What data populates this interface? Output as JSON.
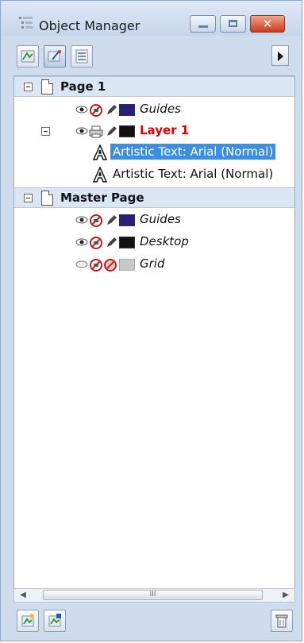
{
  "window": {
    "title": "Object Manager",
    "controls": {
      "minimize": "minimize",
      "maximize": "maximize",
      "close": "✕"
    }
  },
  "toolbar": {
    "buttons": [
      "show-object-properties-icon",
      "edit-across-layers-icon",
      "layer-manager-view-icon"
    ],
    "flyout_arrow": "flyout-menu-arrow-icon"
  },
  "tree": {
    "page1": {
      "label": "Page 1",
      "layers": [
        {
          "label": "Guides",
          "color": "#2a1f7a",
          "style": "italic"
        },
        {
          "label": "Layer 1",
          "color": "#111111",
          "style": "active-red",
          "objects": [
            {
              "label": "Artistic Text: Arial (Normal)",
              "selected": true
            },
            {
              "label": "Artistic Text: Arial (Normal)",
              "selected": false
            }
          ]
        }
      ]
    },
    "master": {
      "label": "Master Page",
      "layers": [
        {
          "label": "Guides",
          "color": "#2a1f7a"
        },
        {
          "label": "Desktop",
          "color": "#111111"
        },
        {
          "label": "Grid",
          "color": "#c8c8c8"
        }
      ]
    }
  },
  "scrollbar": {
    "thumb_grip": "III"
  },
  "bottom": {
    "buttons": [
      "new-layer-icon",
      "new-master-layer-icon"
    ],
    "delete": "delete-icon"
  },
  "colors": {
    "selection": "#3b8ee0",
    "active_layer": "#e00000",
    "page_row": "#dbe6f4"
  }
}
